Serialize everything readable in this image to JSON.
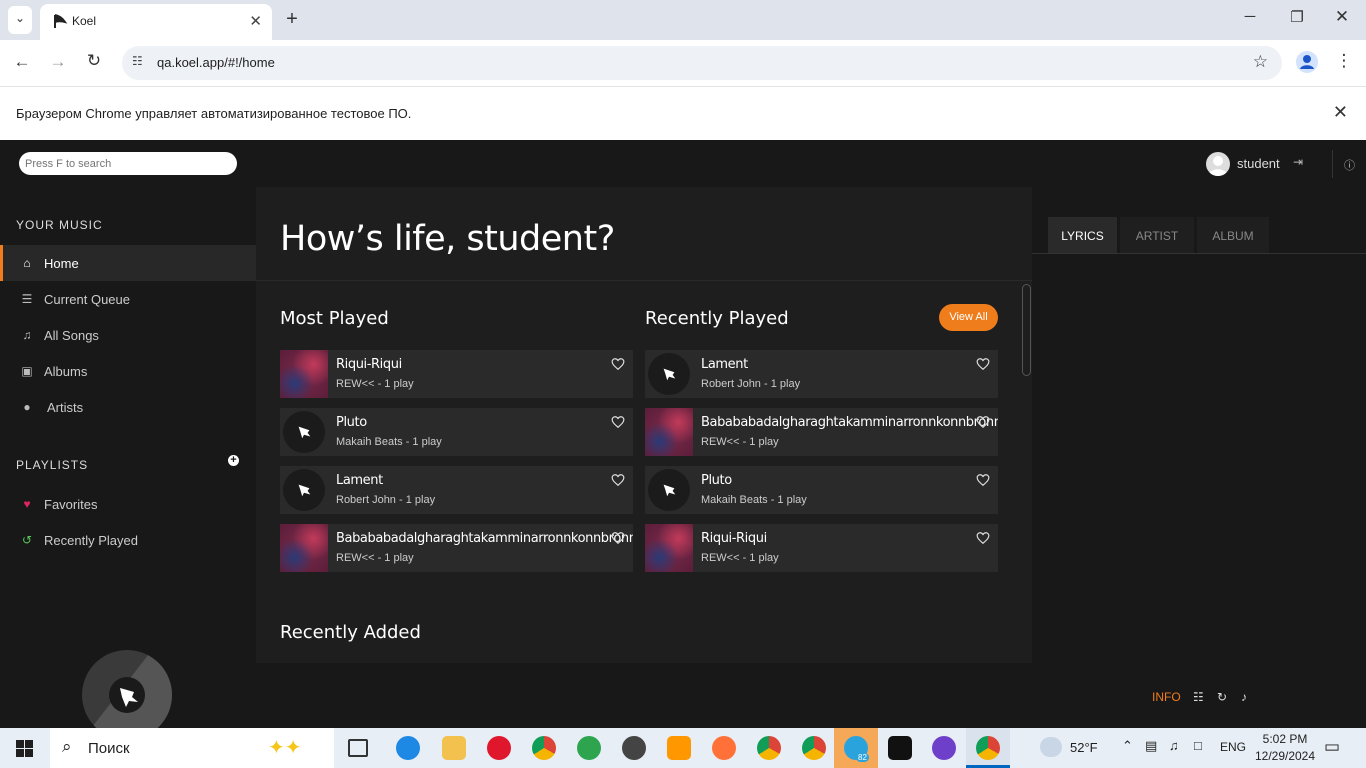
{
  "browser": {
    "tab_title": "Koel",
    "url": "qa.koel.app/#!/home",
    "infobar_text": "Браузером Chrome управляет автоматизированное тестовое ПО."
  },
  "app": {
    "search_placeholder": "Press F to search",
    "username": "student",
    "accent_color": "#f07d1c"
  },
  "sidebar": {
    "your_music_title": "YOUR MUSIC",
    "items": [
      {
        "label": "Home",
        "icon": "home-icon"
      },
      {
        "label": "Current Queue",
        "icon": "list-icon"
      },
      {
        "label": "All Songs",
        "icon": "music-note-icon"
      },
      {
        "label": "Albums",
        "icon": "album-icon"
      },
      {
        "label": "Artists",
        "icon": "microphone-icon"
      }
    ],
    "playlists_title": "PLAYLISTS",
    "playlists": [
      {
        "label": "Favorites",
        "icon": "heart-icon"
      },
      {
        "label": "Recently Played",
        "icon": "history-icon"
      }
    ]
  },
  "main": {
    "greeting": "How’s life, student?",
    "most_played_title": "Most Played",
    "recently_played_title": "Recently Played",
    "view_all_label": "View All",
    "recently_added_title": "Recently Added",
    "most_played": [
      {
        "title": "Riqui-Riqui",
        "artist": "REW<<",
        "plays": " - 1 play",
        "art": "album"
      },
      {
        "title": "Pluto",
        "artist": "Makaih Beats",
        "plays": " - 1 play",
        "art": "default"
      },
      {
        "title": "Lament",
        "artist": "Robert John",
        "plays": " - 1 play",
        "art": "default"
      },
      {
        "title": "Babababadalgharaghtakamminarronnkonnbronntonnerronntuonnthunntrovarrhounawnskawntoohoohoordenenthurnuk",
        "artist": "REW<<",
        "plays": " - 1 play",
        "art": "album"
      }
    ],
    "recently_played": [
      {
        "title": "Lament",
        "artist": "Robert John",
        "plays": " - 1 play",
        "art": "default"
      },
      {
        "title": "Babababadalgharaghtakamminarronnkonnbronntonnerronntuonnthunntrovarrhounawnskawntoohoohoordenenthurnuk",
        "artist": "REW<<",
        "plays": " - 1 play",
        "art": "album"
      },
      {
        "title": "Pluto",
        "artist": "Makaih Beats",
        "plays": " - 1 play",
        "art": "default"
      },
      {
        "title": "Riqui-Riqui",
        "artist": "REW<<",
        "plays": " - 1 play",
        "art": "album"
      }
    ]
  },
  "right_panel": {
    "tabs": [
      "LYRICS",
      "ARTIST",
      "ALBUM"
    ]
  },
  "footer": {
    "info_label": "INFO"
  },
  "taskbar": {
    "search_label": "Поиск",
    "temperature": "52°F",
    "language": "ENG",
    "time": "5:02 PM",
    "date": "12/29/2024",
    "telegram_badge": "82"
  }
}
